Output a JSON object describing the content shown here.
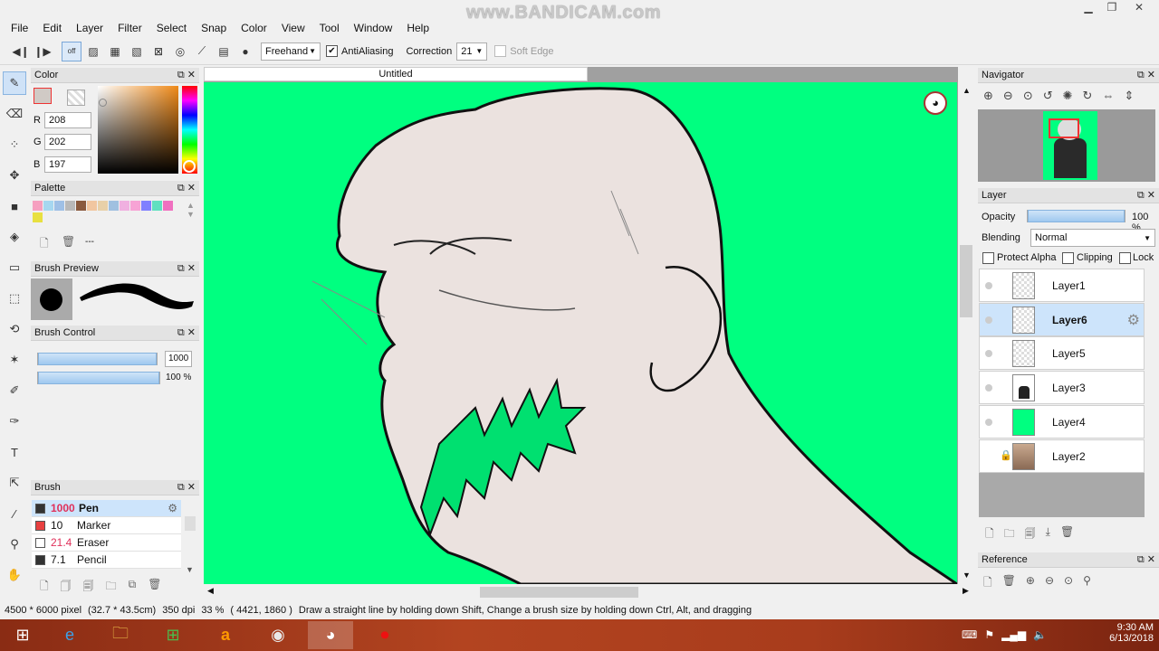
{
  "watermark": "www.BANDICAM.com",
  "menu": [
    "File",
    "Edit",
    "Layer",
    "Filter",
    "Select",
    "Snap",
    "Color",
    "View",
    "Tool",
    "Window",
    "Help"
  ],
  "toolbar": {
    "off_label": "off",
    "mode": "Freehand",
    "antialiasing_label": "AntiAliasing",
    "correction_label": "Correction",
    "correction_value": "21",
    "soft_edge_label": "Soft Edge"
  },
  "color_panel": {
    "title": "Color",
    "r_label": "R",
    "r": "208",
    "g_label": "G",
    "g": "202",
    "b_label": "B",
    "b": "197",
    "current_color": "#d0cac5"
  },
  "palette_panel": {
    "title": "Palette",
    "swatches": [
      "#f6a0c0",
      "#a6d7f0",
      "#9fc0e6",
      "#b9b9b9",
      "#8a5a3e",
      "#f1c6a0",
      "#e8d0a8",
      "#a0c0e0",
      "#f0b0e0",
      "#f7a3d5",
      "#8080ff",
      "#60e0c0",
      "#f070c0",
      "#e8e040"
    ],
    "menu_label": "---"
  },
  "brush_preview_panel": {
    "title": "Brush Preview"
  },
  "brush_control_panel": {
    "title": "Brush Control",
    "size": "1000",
    "density": "100 %",
    "size_fill": 1.0,
    "density_fill": 1.0
  },
  "brush_panel": {
    "title": "Brush",
    "items": [
      {
        "size": "1000",
        "name": "Pen",
        "color": "#333333"
      },
      {
        "size": "10",
        "name": "Marker",
        "color": "#e84040"
      },
      {
        "size": "21.4",
        "name": "Eraser",
        "color": "#ffffff"
      },
      {
        "size": "7.1",
        "name": "Pencil",
        "color": "#333333"
      }
    ]
  },
  "document": {
    "tab": "Untitled"
  },
  "navigator_panel": {
    "title": "Navigator"
  },
  "layer_panel": {
    "title": "Layer",
    "opacity_label": "Opacity",
    "opacity_value": "100 %",
    "opacity_fill": 1.0,
    "blending_label": "Blending",
    "blending_value": "Normal",
    "protect_alpha": "Protect Alpha",
    "clipping": "Clipping",
    "lock": "Lock",
    "layers": [
      {
        "name": "Layer1",
        "selected": false
      },
      {
        "name": "Layer6",
        "selected": true
      },
      {
        "name": "Layer5",
        "selected": false
      },
      {
        "name": "Layer3",
        "selected": false
      },
      {
        "name": "Layer4",
        "selected": false
      },
      {
        "name": "Layer2",
        "selected": false
      }
    ]
  },
  "reference_panel": {
    "title": "Reference"
  },
  "status": {
    "dimensions": "4500 * 6000 pixel",
    "size_cm": "(32.7 * 43.5cm)",
    "dpi": "350 dpi",
    "zoom": "33 %",
    "coords": "( 4421, 1860 )",
    "hint": "Draw a straight line by holding down Shift, Change a brush size by holding down Ctrl, Alt, and dragging"
  },
  "taskbar": {
    "time": "9:30 AM",
    "date": "6/13/2018"
  },
  "accent_color": "#00ff80"
}
